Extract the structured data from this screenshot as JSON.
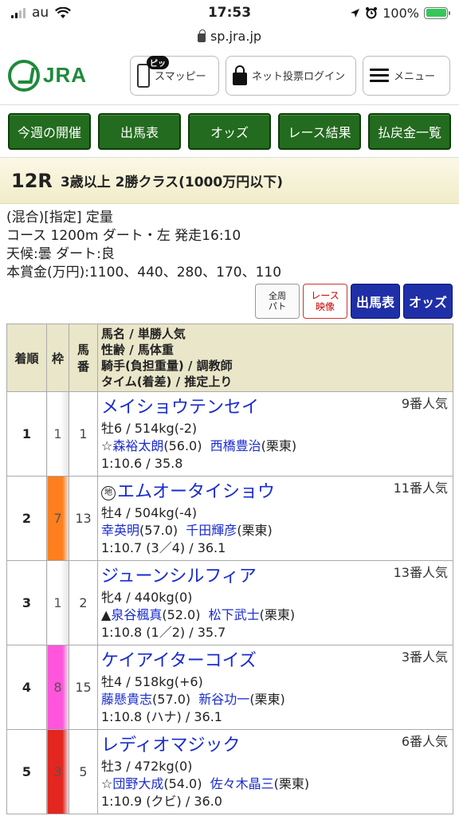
{
  "status": {
    "carrier": "au",
    "time": "17:53",
    "battery": "100%"
  },
  "url": "sp.jra.jp",
  "header": {
    "logo": "JRA",
    "badge": "ピッ",
    "smappy": "スマッピー",
    "login": "ネット投票ログイン",
    "menu": "メニュー"
  },
  "nav": [
    "今週の開催",
    "出馬表",
    "オッズ",
    "レース結果",
    "払戻金一覧"
  ],
  "race": {
    "no": "12R",
    "name": "3歳以上 2勝クラス(1000万円以下)",
    "line1": "(混合)[指定] 定量",
    "line2": "コース 1200m ダート・左 発走16:10",
    "line3": "天候:曇 ダート:良",
    "line4": "本賞金(万円):1100、440、280、170、110"
  },
  "actions": {
    "patrol_1": "全周",
    "patrol_2": "パト",
    "video_1": "レース",
    "video_2": "映像",
    "entries": "出馬表",
    "odds": "オッズ"
  },
  "table": {
    "h_rank": "着順",
    "h_waku": "枠",
    "h_uma_1": "馬",
    "h_uma_2": "番",
    "h_names_1": "馬名 / 単勝人気",
    "h_names_2": "性齢 / 馬体重",
    "h_names_3": "騎手(負担重量) / 調教師",
    "h_names_4": "タイム(着差) / 推定上り",
    "rows": [
      {
        "rank": "1",
        "waku": "1",
        "uma": "1",
        "chihou": "",
        "horse": "メイショウテンセイ",
        "pop": "9番人気",
        "sexage": "牡6 / 514kg(-2)",
        "jmark": "☆",
        "jockey": "森裕太朗",
        "jweight": "(56.0)",
        "trainer": "西橋豊治",
        "stable": "(栗東)",
        "time": "1:10.6 / 35.8"
      },
      {
        "rank": "2",
        "waku": "7",
        "uma": "13",
        "chihou": "地",
        "horse": "エムオータイショウ",
        "pop": "11番人気",
        "sexage": "牡4 / 504kg(-4)",
        "jmark": "",
        "jockey": "幸英明",
        "jweight": "(57.0)",
        "trainer": "千田輝彦",
        "stable": "(栗東)",
        "time": "1:10.7 (3／4) / 36.1"
      },
      {
        "rank": "3",
        "waku": "1",
        "uma": "2",
        "chihou": "",
        "horse": "ジューンシルフィア",
        "pop": "13番人気",
        "sexage": "牝4 / 440kg(0)",
        "jmark": "▲",
        "jockey": "泉谷楓真",
        "jweight": "(52.0)",
        "trainer": "松下武士",
        "stable": "(栗東)",
        "time": "1:10.8 (1／2) / 35.7"
      },
      {
        "rank": "4",
        "waku": "8",
        "uma": "15",
        "chihou": "",
        "horse": "ケイアイターコイズ",
        "pop": "3番人気",
        "sexage": "牡4 / 518kg(+6)",
        "jmark": "",
        "jockey": "藤懸貴志",
        "jweight": "(57.0)",
        "trainer": "新谷功一",
        "stable": "(栗東)",
        "time": "1:10.8 (ハナ) / 36.1"
      },
      {
        "rank": "5",
        "waku": "3",
        "uma": "5",
        "chihou": "",
        "horse": "レディオマジック",
        "pop": "6番人気",
        "sexage": "牡3 / 472kg(0)",
        "jmark": "☆",
        "jockey": "団野大成",
        "jweight": "(54.0)",
        "trainer": "佐々木晶三",
        "stable": "(栗東)",
        "time": "1:10.9 (クビ) / 36.0"
      }
    ]
  },
  "colors": {
    "jra_green": "#1f8a3a",
    "nav_green": "#236b1e",
    "link_blue": "#1a2ccf",
    "button_blue": "#1e2fa8",
    "header_beige": "#e9e6c9",
    "waku": {
      "1": "#ffffff",
      "3": "#e3261f",
      "7": "#ff7f1e",
      "8": "#ff55dd"
    }
  }
}
